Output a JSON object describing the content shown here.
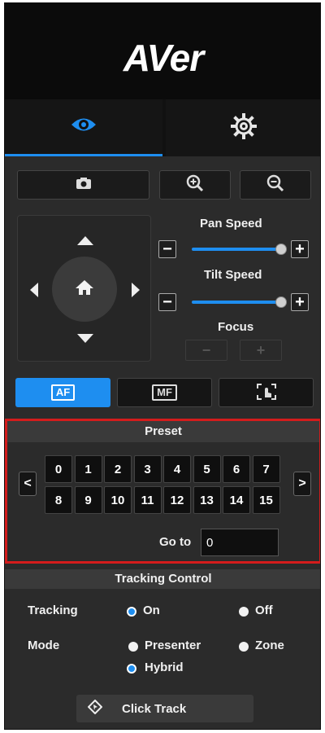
{
  "header": {
    "logo": "AVer"
  },
  "tabs": [
    {
      "name": "view",
      "icon": "eye-icon",
      "active": true
    },
    {
      "name": "settings",
      "icon": "gear-icon",
      "active": false
    }
  ],
  "toolbar": {
    "snapshot_icon": "camera-icon",
    "zoom_in_icon": "zoom-in-icon",
    "zoom_out_icon": "zoom-out-icon"
  },
  "ptz": {
    "pan_speed_label": "Pan Speed",
    "tilt_speed_label": "Tilt Speed",
    "focus_label": "Focus",
    "minus": "−",
    "plus": "+",
    "pan_speed_level": 1.0,
    "tilt_speed_level": 1.0
  },
  "focus_modes": {
    "af": "AF",
    "mf": "MF"
  },
  "preset": {
    "title": "Preset",
    "prev": "<",
    "next": ">",
    "numbers": [
      "0",
      "1",
      "2",
      "3",
      "4",
      "5",
      "6",
      "7",
      "8",
      "9",
      "10",
      "11",
      "12",
      "13",
      "14",
      "15"
    ],
    "goto_label": "Go to",
    "goto_value": "0"
  },
  "tracking": {
    "title": "Tracking Control",
    "tracking_label": "Tracking",
    "on_label": "On",
    "off_label": "Off",
    "tracking_selected": "On",
    "mode_label": "Mode",
    "presenter_label": "Presenter",
    "zone_label": "Zone",
    "hybrid_label": "Hybrid",
    "mode_selected": "Hybrid",
    "click_track_label": "Click Track"
  },
  "colors": {
    "accent": "#1e8ef0",
    "highlight_border": "#d41c1c",
    "panel_bg": "#2b2b2b"
  }
}
